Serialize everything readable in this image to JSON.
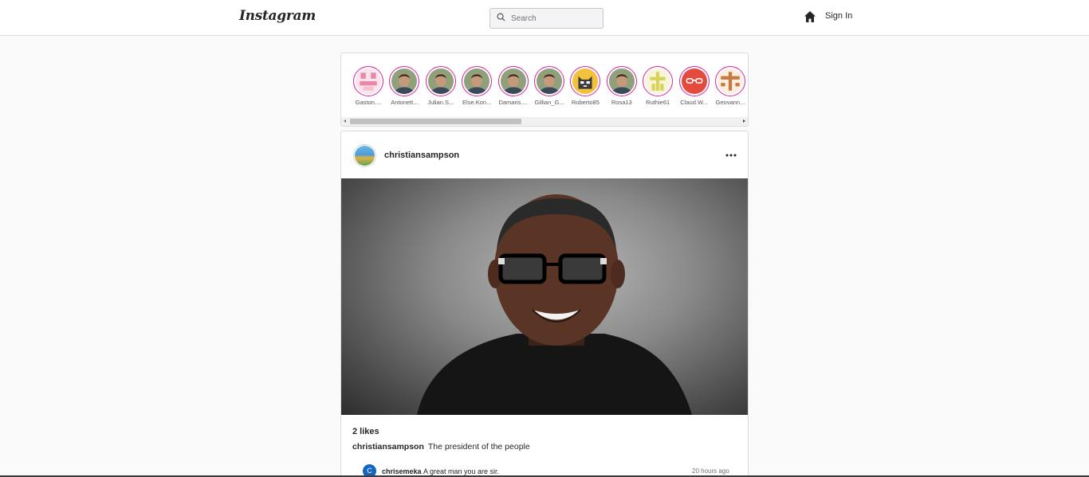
{
  "header": {
    "logo": "Instagram",
    "search_placeholder": "Search",
    "signin": "Sign In"
  },
  "stories": [
    {
      "name": "Gaston....",
      "avatar": "pink-identicon"
    },
    {
      "name": "Antonett...",
      "avatar": "photo-man"
    },
    {
      "name": "Julian.S...",
      "avatar": "photo-man"
    },
    {
      "name": "Else.Kon...",
      "avatar": "photo-man"
    },
    {
      "name": "Damaris....",
      "avatar": "photo-man"
    },
    {
      "name": "Gillian_G...",
      "avatar": "photo-man"
    },
    {
      "name": "Roberto85",
      "avatar": "cat-avatar"
    },
    {
      "name": "Rosa13",
      "avatar": "photo-man"
    },
    {
      "name": "Ruthie61",
      "avatar": "yellow-identicon"
    },
    {
      "name": "Claud.W...",
      "avatar": "glasses-avatar"
    },
    {
      "name": "Geovann...",
      "avatar": "brown-identicon"
    }
  ],
  "post": {
    "username": "christiansampson",
    "likes": "2 likes",
    "caption_user": "christiansampson",
    "caption_text": "The president of the people",
    "comments": [
      {
        "initial": "C",
        "user": "chrisemeka",
        "text": "A great man you are sir.",
        "time": "20 hours ago"
      }
    ]
  },
  "colors": {
    "story_ring": "#d6249f",
    "background": "#fafafa",
    "border": "#dbdbdb"
  }
}
